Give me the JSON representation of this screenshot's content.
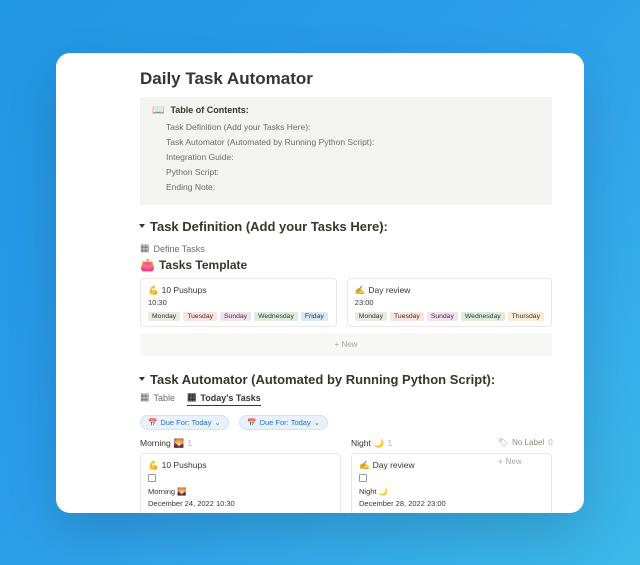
{
  "page": {
    "title": "Daily Task Automator"
  },
  "toc": {
    "icon": "📖",
    "title": "Table of Contents:",
    "items": [
      "Task Definition (Add your Tasks Here):",
      "Task Automator (Automated by Running Python Script):",
      "Integration Guide:",
      "Python Script:",
      "Ending Note:"
    ]
  },
  "section1": {
    "heading": "Task Definition (Add your Tasks Here):",
    "db_tab_label": "Define Tasks",
    "db_title_emoji": "👛",
    "db_title": "Tasks Template",
    "cards": [
      {
        "emoji": "💪",
        "title": "10 Pushups",
        "time": "10:30",
        "tags": [
          "Monday",
          "Tuesday",
          "Sunday",
          "Wednesday",
          "Friday"
        ]
      },
      {
        "emoji": "✍️",
        "title": "Day review",
        "time": "23:00",
        "tags": [
          "Monday",
          "Tuesday",
          "Sunday",
          "Wednesday",
          "Thursday"
        ]
      }
    ],
    "new_label": "+  New"
  },
  "tag_colors": {
    "Monday": "#e9e9e6",
    "Tuesday": "#fde2dd",
    "Sunday": "#f3e0ef",
    "Wednesday": "#dbecdc",
    "Friday": "#d6e7f5",
    "Thursday": "#fcebd6"
  },
  "section2": {
    "heading": "Task Automator (Automated by Running Python Script):",
    "tabs": [
      {
        "icon": "▦",
        "label": "Table"
      },
      {
        "icon": "▦",
        "label": "Today's Tasks"
      }
    ],
    "filters": [
      {
        "label": "Due For: Today",
        "chevron": "⌄"
      },
      {
        "label": "Due For: Today",
        "chevron": "⌄"
      }
    ],
    "columns": [
      {
        "name": "Morning",
        "emoji": "🌄",
        "count": "1",
        "card": {
          "emoji": "💪",
          "title": "10 Pushups",
          "label_text": "Morning",
          "label_emoji": "🌄",
          "date": "December 24, 2022 10:30"
        }
      },
      {
        "name": "Night",
        "emoji": "🌙",
        "count": "1",
        "card": {
          "emoji": "✍️",
          "title": "Day review",
          "label_text": "Night",
          "label_emoji": "🌙",
          "date": "December 28, 2022 23:00"
        }
      }
    ],
    "no_label_col": {
      "icon": "🏷",
      "label": "No Label",
      "count": "0"
    },
    "add_new": "New"
  }
}
